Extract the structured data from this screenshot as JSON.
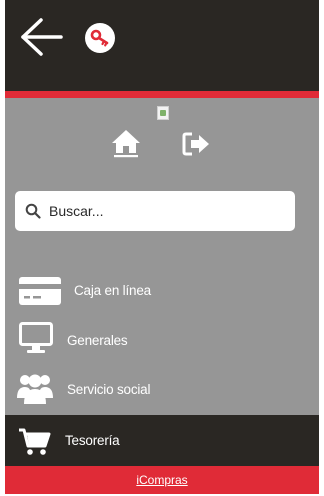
{
  "header": {
    "back_icon": "arrow-left-icon",
    "key_icon": "key-icon"
  },
  "toolbar": {
    "home_icon": "home-icon",
    "logout_icon": "sign-out-icon"
  },
  "search": {
    "placeholder": "Buscar..."
  },
  "menu": {
    "items": [
      {
        "label": "Caja en línea",
        "icon": "credit-card-icon"
      },
      {
        "label": "Generales",
        "icon": "monitor-icon"
      },
      {
        "label": "Servicio social",
        "icon": "users-icon"
      },
      {
        "label": "Tesorería",
        "icon": "shopping-cart-icon",
        "active": true
      }
    ]
  },
  "footer": {
    "link_label": "iCompras"
  },
  "colors": {
    "dark": "#2a2723",
    "accent_red": "#e02b37",
    "panel_gray": "#969696"
  }
}
